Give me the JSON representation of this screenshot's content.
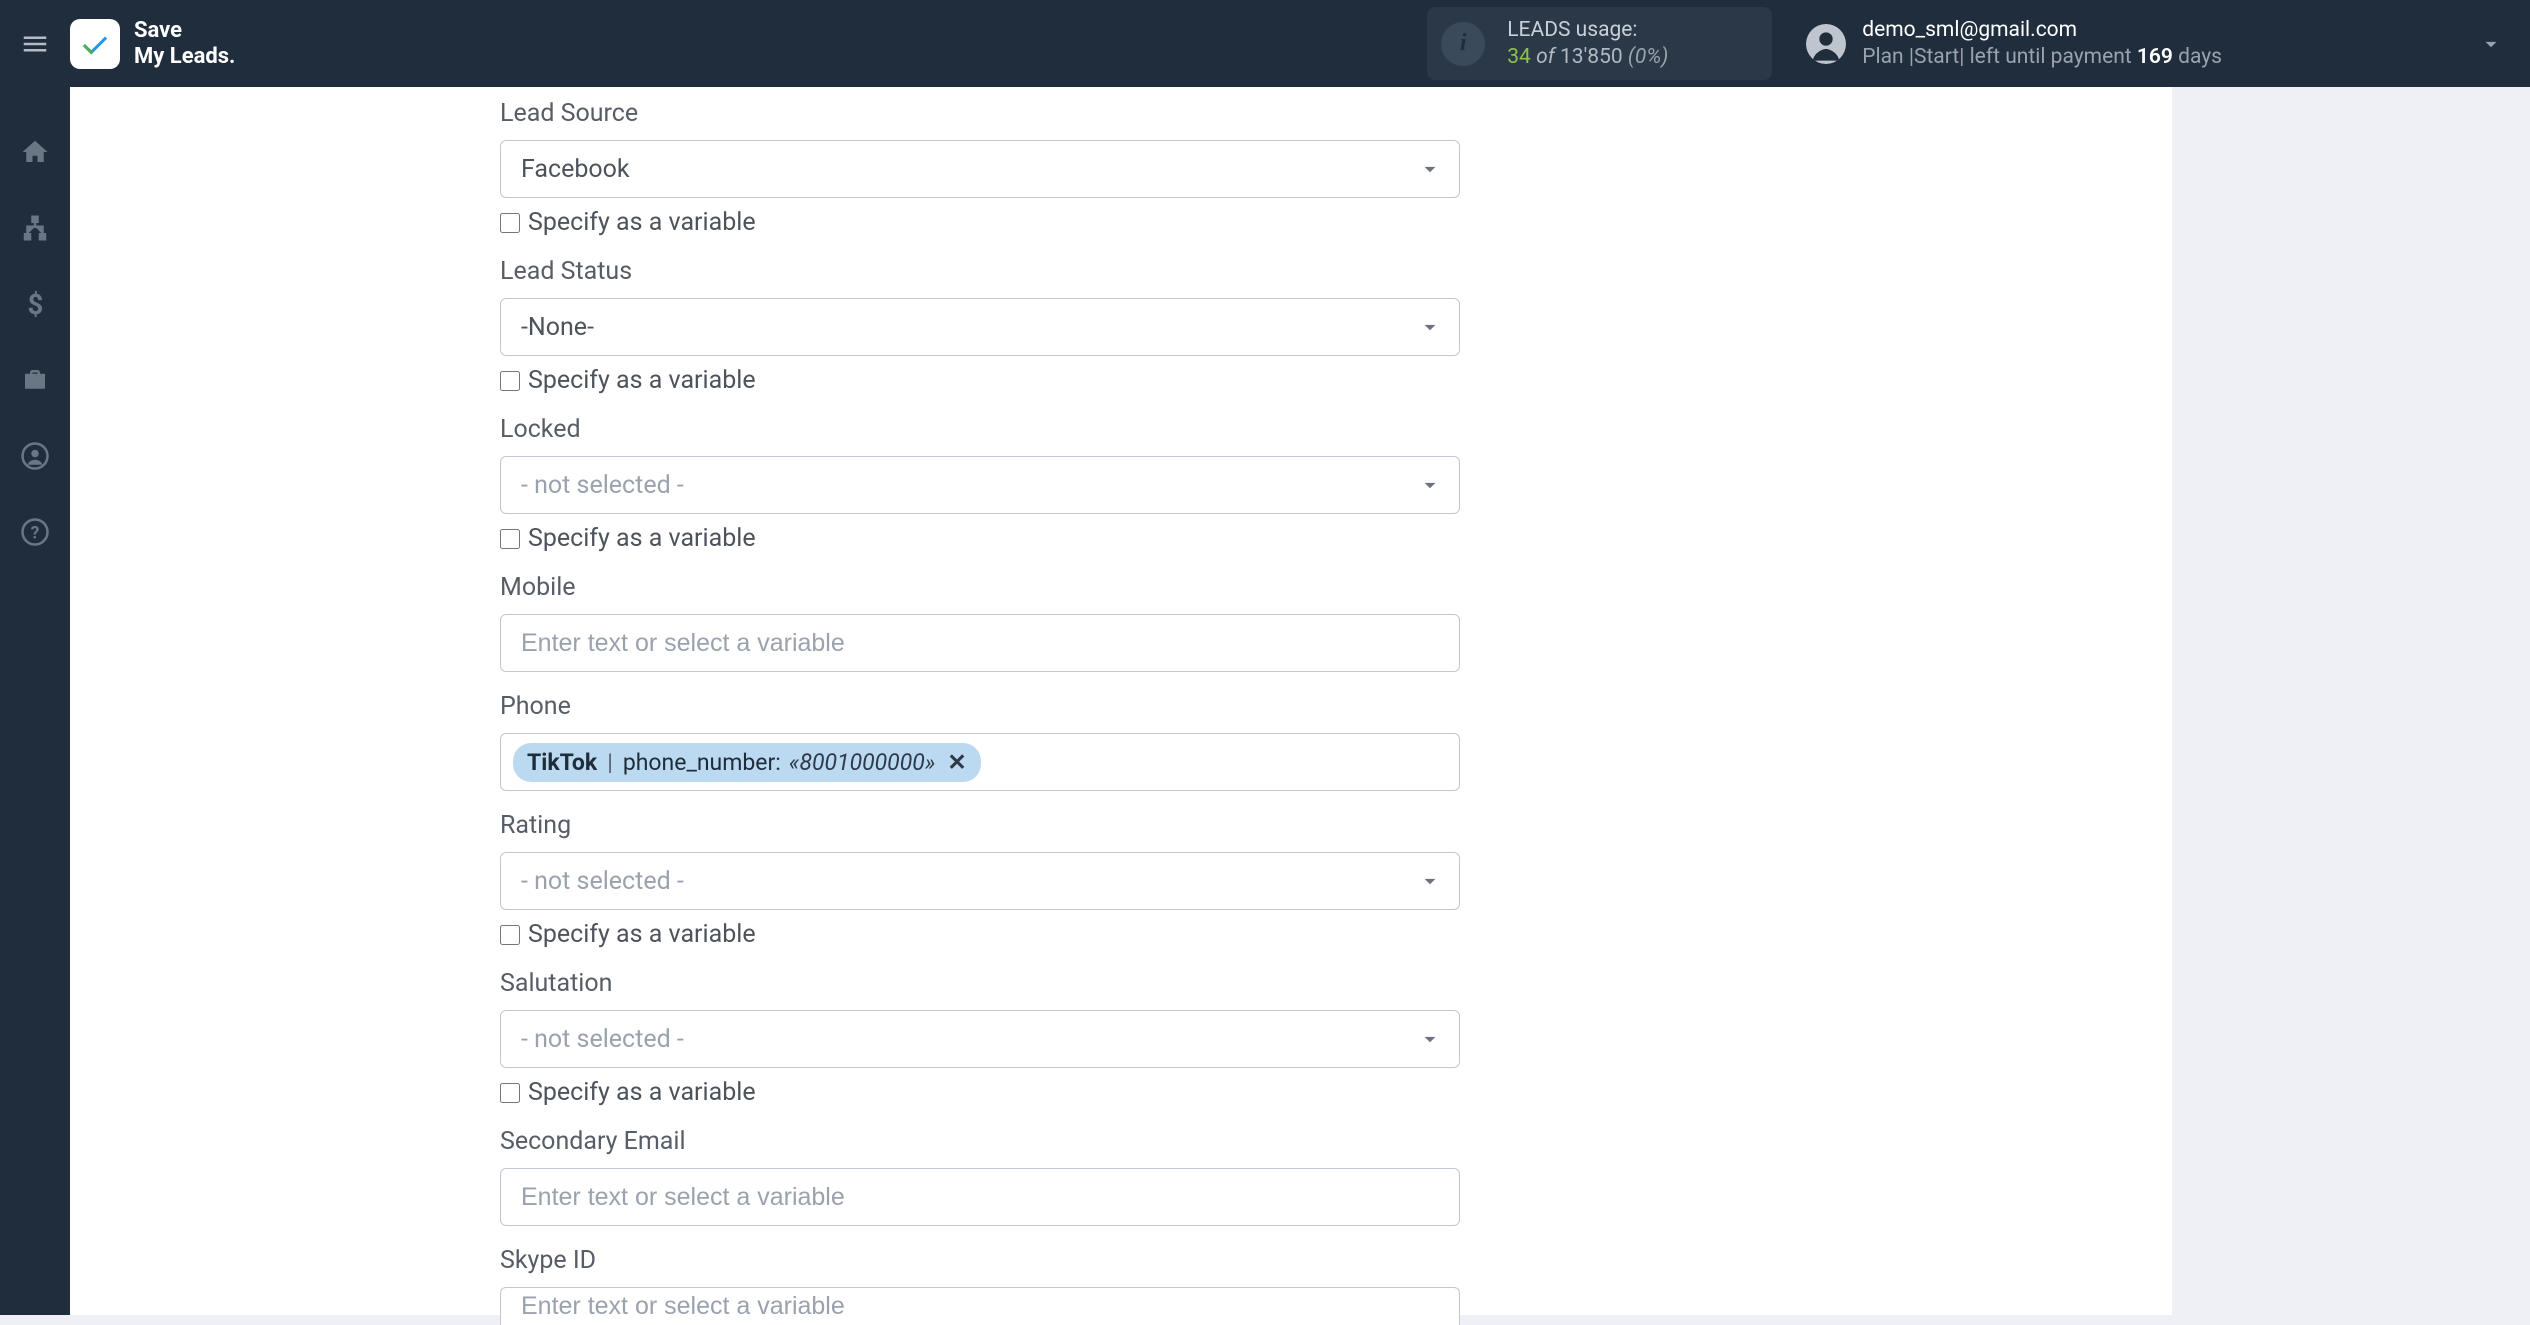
{
  "header": {
    "app_name_line1": "Save",
    "app_name_line2": "My Leads.",
    "usage": {
      "label": "LEADS usage:",
      "count": "34",
      "of": "of",
      "total": "13'850",
      "pct": "(0%)"
    },
    "user": {
      "email": "demo_sml@gmail.com",
      "plan_prefix": "Plan |",
      "plan_name": "Start",
      "plan_suffix": "| left until payment ",
      "days": "169",
      "days_label": " days"
    }
  },
  "sidebar": {
    "items": [
      {
        "name": "home-icon"
      },
      {
        "name": "sitemap-icon"
      },
      {
        "name": "dollar-icon"
      },
      {
        "name": "briefcase-icon"
      },
      {
        "name": "user-circle-icon"
      },
      {
        "name": "help-icon"
      }
    ]
  },
  "form": {
    "variable_hint": "Specify as a variable",
    "input_placeholder": "Enter text or select a variable",
    "fields": {
      "lead_source": {
        "label": "Lead Source",
        "value": "Facebook"
      },
      "lead_status": {
        "label": "Lead Status",
        "value": "-None-"
      },
      "locked": {
        "label": "Locked",
        "value": "- not selected -"
      },
      "mobile": {
        "label": "Mobile"
      },
      "phone": {
        "label": "Phone",
        "chip": {
          "source": "TikTok",
          "field": "phone_number:",
          "value": "«8001000000»"
        }
      },
      "rating": {
        "label": "Rating",
        "value": "- not selected -"
      },
      "salutation": {
        "label": "Salutation",
        "value": "- not selected -"
      },
      "secondary_email": {
        "label": "Secondary Email"
      },
      "skype_id": {
        "label": "Skype ID"
      }
    }
  }
}
